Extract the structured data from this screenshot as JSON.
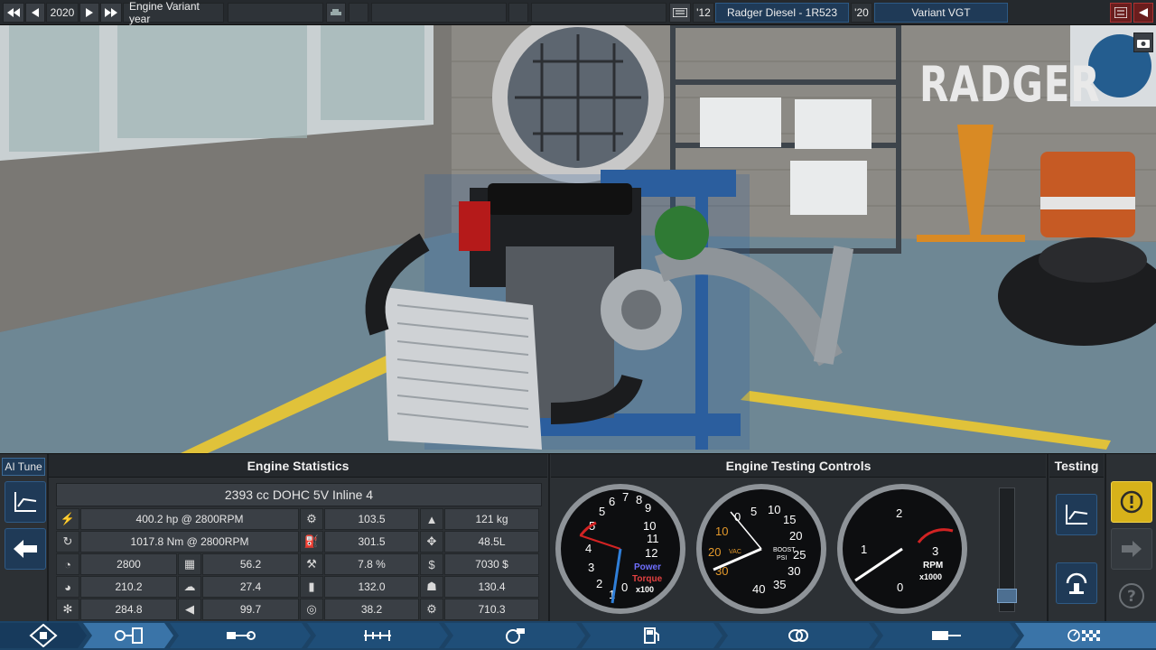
{
  "topbar": {
    "year": "2020",
    "year_label": "Engine Variant year",
    "family_year": "'12",
    "family_name": "Radger Diesel - 1R523",
    "variant_year": "'20",
    "variant_name": "Variant VGT"
  },
  "scene": {
    "brand": "RADGER"
  },
  "panel": {
    "ai_tune": "AI Tune",
    "stats_header": "Engine Statistics",
    "controls_header": "Engine Testing Controls",
    "testing_header": "Testing",
    "engine_title": "2393 cc DOHC 5V  Inline 4",
    "rows": [
      {
        "icon1": "power-icon",
        "v1": "400.2 hp @ 2800RPM",
        "icon2": "engine-block-icon",
        "v2": "103.5",
        "icon3": "weight-icon",
        "v3": "121 kg"
      },
      {
        "icon1": "torque-icon",
        "v1": "1017.8 Nm @ 2800RPM",
        "icon2": "fuel-economy-icon",
        "v2": "301.5",
        "icon3": "size-icon",
        "v3": "48.5L"
      },
      {
        "icon1": "rpm-icon",
        "v1": "2800",
        "icon1b": "radiator-icon",
        "v1b": "56.2",
        "icon2": "efficiency-icon",
        "v2": "7.8 %",
        "icon3": "cost-icon",
        "v3": "7030 $"
      },
      {
        "icon1": "redline-icon",
        "v1": "210.2",
        "icon1b": "emissions-icon",
        "v1b": "27.4",
        "icon2": "fuel-pump-icon",
        "v2": "132.0",
        "icon3": "service-icon",
        "v3": "130.4"
      },
      {
        "icon1": "cooling-icon",
        "v1": "284.8",
        "icon1b": "noise-icon",
        "v1b": "99.7",
        "icon2": "intake-icon",
        "v2": "38.2",
        "icon3": "reliability-icon",
        "v3": "710.3"
      }
    ],
    "gauge_power": {
      "label1": "Power",
      "label2": "Torque",
      "unit": "x100",
      "ticks": [
        "0",
        "1",
        "2",
        "3",
        "4",
        "5",
        "6",
        "7",
        "8",
        "9",
        "10",
        "11",
        "12"
      ]
    },
    "gauge_boost": {
      "vac_label": "VAC",
      "boost_label": "BOOST",
      "psi_label": "PSI",
      "vac_ticks": [
        "0",
        "10",
        "20",
        "30"
      ],
      "boost_ticks": [
        "0",
        "5",
        "10",
        "15",
        "20",
        "25",
        "30",
        "35",
        "40"
      ]
    },
    "gauge_rpm": {
      "label": "RPM",
      "unit": "x1000",
      "ticks": [
        "0",
        "1",
        "2",
        "3"
      ]
    },
    "throttle_level": 0.05
  },
  "colors": {
    "accent_blue": "#1f4e78",
    "warning_yellow": "#d7b21a",
    "redline": "#d22323",
    "power_text": "#6f6fff",
    "torque_text": "#e24141",
    "boost_orange": "#e4992b"
  }
}
